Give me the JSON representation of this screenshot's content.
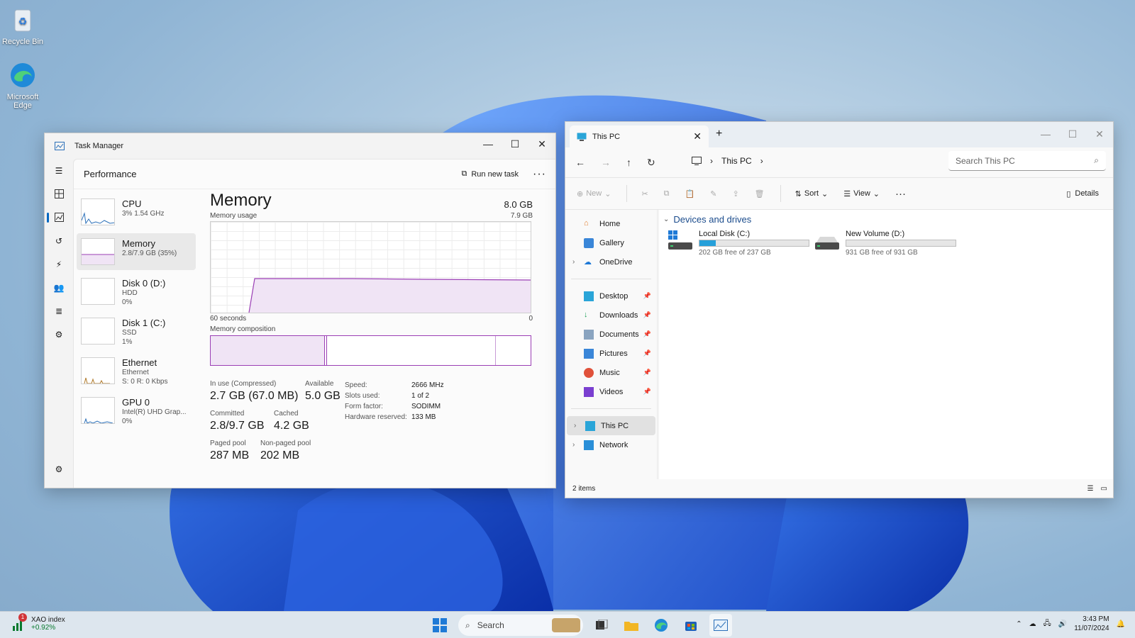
{
  "desktop": {
    "icons": [
      {
        "label": "Recycle Bin",
        "icon": "recycle-bin-icon"
      },
      {
        "label": "Microsoft Edge",
        "icon": "edge-icon"
      }
    ]
  },
  "task_manager": {
    "title": "Task Manager",
    "page_title": "Performance",
    "run_new_task": "Run new task",
    "items": [
      {
        "name": "CPU",
        "sub1": "3% 1.54 GHz",
        "sub2": ""
      },
      {
        "name": "Memory",
        "sub1": "2.8/7.9 GB (35%)",
        "sub2": ""
      },
      {
        "name": "Disk 0 (D:)",
        "sub1": "HDD",
        "sub2": "0%"
      },
      {
        "name": "Disk 1 (C:)",
        "sub1": "SSD",
        "sub2": "1%"
      },
      {
        "name": "Ethernet",
        "sub1": "Ethernet",
        "sub2": "S: 0 R: 0 Kbps"
      },
      {
        "name": "GPU 0",
        "sub1": "Intel(R) UHD Grap...",
        "sub2": "0%"
      }
    ],
    "detail": {
      "title": "Memory",
      "total": "8.0 GB",
      "usage_label": "Memory usage",
      "usage_max": "7.9 GB",
      "axis_left": "60 seconds",
      "axis_right": "0",
      "composition_label": "Memory composition",
      "in_use_label": "In use (Compressed)",
      "in_use_value": "2.7 GB (67.0 MB)",
      "available_label": "Available",
      "available_value": "5.0 GB",
      "committed_label": "Committed",
      "committed_value": "2.8/9.7 GB",
      "cached_label": "Cached",
      "cached_value": "4.2 GB",
      "paged_label": "Paged pool",
      "paged_value": "287 MB",
      "nonpaged_label": "Non-paged pool",
      "nonpaged_value": "202 MB",
      "speed_label": "Speed:",
      "speed_value": "2666 MHz",
      "slots_label": "Slots used:",
      "slots_value": "1 of 2",
      "form_label": "Form factor:",
      "form_value": "SODIMM",
      "hwres_label": "Hardware reserved:",
      "hwres_value": "133 MB"
    }
  },
  "explorer": {
    "tab_title": "This PC",
    "breadcrumb": "This PC",
    "search_placeholder": "Search This PC",
    "cmd": {
      "new": "New",
      "sort": "Sort",
      "view": "View",
      "details": "Details"
    },
    "nav": [
      {
        "label": "Home",
        "icon": "home-icon",
        "pin": false,
        "chev": false
      },
      {
        "label": "Gallery",
        "icon": "gallery-icon",
        "pin": false,
        "chev": false
      },
      {
        "label": "OneDrive",
        "icon": "onedrive-icon",
        "pin": false,
        "chev": true
      }
    ],
    "quick": [
      {
        "label": "Desktop",
        "icon": "desktop-icon"
      },
      {
        "label": "Downloads",
        "icon": "downloads-icon"
      },
      {
        "label": "Documents",
        "icon": "documents-icon"
      },
      {
        "label": "Pictures",
        "icon": "pictures-icon"
      },
      {
        "label": "Music",
        "icon": "music-icon"
      },
      {
        "label": "Videos",
        "icon": "videos-icon"
      }
    ],
    "places": [
      {
        "label": "This PC",
        "icon": "this-pc-icon"
      },
      {
        "label": "Network",
        "icon": "network-icon"
      }
    ],
    "section_title": "Devices and drives",
    "drives": [
      {
        "name": "Local Disk (C:)",
        "free": "202 GB free of 237 GB",
        "used_fraction": 0.15
      },
      {
        "name": "New Volume (D:)",
        "free": "931 GB free of 931 GB",
        "used_fraction": 0.0
      }
    ],
    "status": "2 items"
  },
  "taskbar": {
    "stock_name": "XAO index",
    "stock_change": "+0.92%",
    "stock_badge": "1",
    "search": "Search",
    "time": "3:43 PM",
    "date": "11/07/2024"
  },
  "colors": {
    "accent": "#0067c0",
    "memory": "#9b3fb5",
    "drive_fill": "#26a0da"
  }
}
